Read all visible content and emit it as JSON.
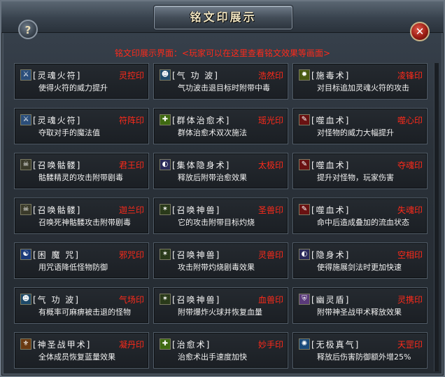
{
  "window": {
    "title": "铭文印展示",
    "subtitle": "铭文印展示界面：<玩家可以在这里查看铭文效果等画面>",
    "help_label": "?",
    "close_label": "✕"
  },
  "icons": {
    "sword": {
      "glyph": "⚔",
      "bg": "#2b4e7a"
    },
    "ghost": {
      "glyph": "☻",
      "bg": "#1e4a6a"
    },
    "poison": {
      "glyph": "✹",
      "bg": "#4a5a12"
    },
    "heal": {
      "glyph": "✚",
      "bg": "#3f6a12"
    },
    "blood": {
      "glyph": "✎",
      "bg": "#6a1212"
    },
    "skull": {
      "glyph": "☠",
      "bg": "#3a3a2a"
    },
    "stealth": {
      "glyph": "◐",
      "bg": "#2a2a5a"
    },
    "beast": {
      "glyph": "✶",
      "bg": "#2a3a1a"
    },
    "curse": {
      "glyph": "☯",
      "bg": "#1a3a7a"
    },
    "shield": {
      "glyph": "⛨",
      "bg": "#5a3a7a"
    },
    "armor": {
      "glyph": "⚜",
      "bg": "#6a3a12"
    },
    "orb": {
      "glyph": "✺",
      "bg": "#1a4a7a"
    }
  },
  "cells": [
    {
      "icon": "sword",
      "skill": "[灵魂火符]",
      "mark": "灵控印",
      "desc": "使得火符的威力提升"
    },
    {
      "icon": "ghost",
      "skill": "[气 功 波]",
      "mark": "浩然印",
      "desc": "气功波击退目标时附带中毒"
    },
    {
      "icon": "poison",
      "skill": "[施毒术]",
      "mark": "凌锋印",
      "desc": "对目标追加灵魂火符的攻击"
    },
    {
      "icon": "sword",
      "skill": "[灵魂火符]",
      "mark": "符阵印",
      "desc": "夺取对手的魔法值"
    },
    {
      "icon": "heal",
      "skill": "[群体治愈术]",
      "mark": "瑶光印",
      "desc": "群体治愈术双次施法"
    },
    {
      "icon": "blood",
      "skill": "[噬血术]",
      "mark": "噬心印",
      "desc": "对怪物的威力大幅提升"
    },
    {
      "icon": "skull",
      "skill": "[召唤骷髅]",
      "mark": "君王印",
      "desc": "骷髅精灵的攻击附带剧毒"
    },
    {
      "icon": "stealth",
      "skill": "[集体隐身术]",
      "mark": "太极印",
      "desc": "释放后附带治愈效果"
    },
    {
      "icon": "blood",
      "skill": "[噬血术]",
      "mark": "夺魂印",
      "desc": "提升对怪物，玩家伤害"
    },
    {
      "icon": "skull",
      "skill": "[召唤骷髅]",
      "mark": "迦兰印",
      "desc": "召唤死神骷髅攻击附带剧毒"
    },
    {
      "icon": "beast",
      "skill": "[召唤神兽]",
      "mark": "圣兽印",
      "desc": "它的攻击附带目标灼烧"
    },
    {
      "icon": "blood",
      "skill": "[噬血术]",
      "mark": "失魂印",
      "desc": "命中后造成叠加的流血状态"
    },
    {
      "icon": "curse",
      "skill": "[困 魔 咒]",
      "mark": "邪咒印",
      "desc": "用咒语降低怪物防御"
    },
    {
      "icon": "beast",
      "skill": "[召唤神兽]",
      "mark": "灵兽印",
      "desc": "攻击附带灼烧剧毒效果"
    },
    {
      "icon": "stealth",
      "skill": "[隐身术]",
      "mark": "空相印",
      "desc": "使得施展剑法时更加快速"
    },
    {
      "icon": "ghost",
      "skill": "[气 功 波]",
      "mark": "气场印",
      "desc": "有概率可麻痹被击退的怪物"
    },
    {
      "icon": "beast",
      "skill": "[召唤神兽]",
      "mark": "血兽印",
      "desc": "附带爆炸火球并恢复血量"
    },
    {
      "icon": "shield",
      "skill": "[幽灵盾]",
      "mark": "灵携印",
      "desc": "附带神圣战甲术释放效果"
    },
    {
      "icon": "armor",
      "skill": "[神圣战甲术]",
      "mark": "凝丹印",
      "desc": "全体成员恢复蓝量效果"
    },
    {
      "icon": "heal",
      "skill": "[治愈术]",
      "mark": "妙手印",
      "desc": "治愈术出手速度加快"
    },
    {
      "icon": "orb",
      "skill": "[无极真气]",
      "mark": "天罡印",
      "desc": "释放后伤害防御额外增25%"
    }
  ]
}
